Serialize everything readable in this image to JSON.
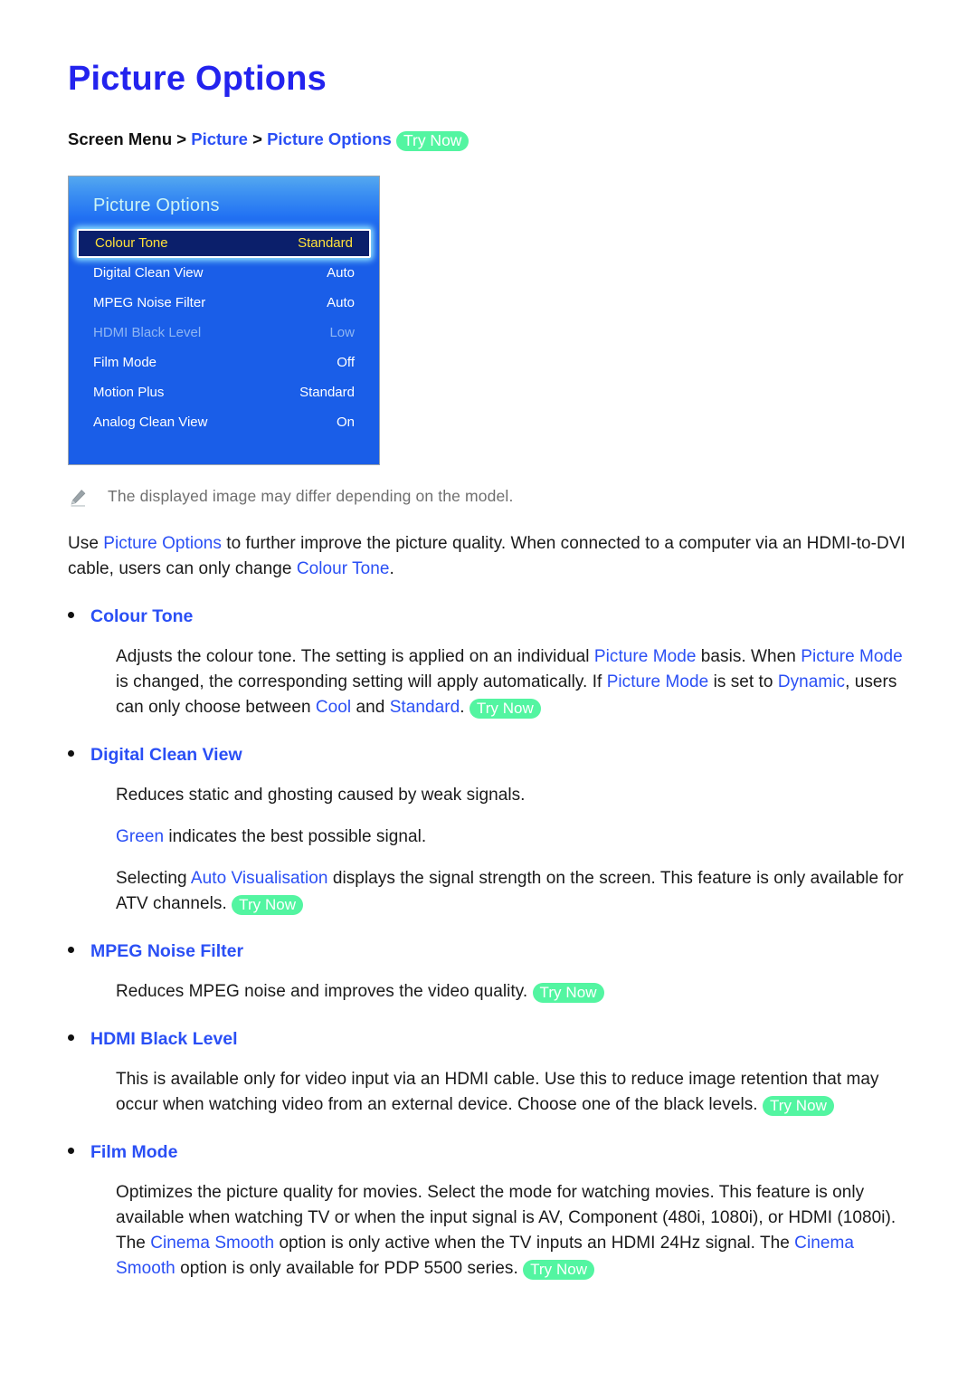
{
  "page": {
    "title": "Picture Options"
  },
  "breadcrumb": {
    "root": "Screen Menu",
    "sep1": ">",
    "level2": "Picture",
    "sep2": ">",
    "level3": "Picture Options",
    "try_now": "Try Now"
  },
  "tv_menu": {
    "title": "Picture Options",
    "rows": [
      {
        "label": "Colour Tone",
        "value": "Standard",
        "state": "selected"
      },
      {
        "label": "Digital Clean View",
        "value": "Auto",
        "state": "normal"
      },
      {
        "label": "MPEG Noise Filter",
        "value": "Auto",
        "state": "normal"
      },
      {
        "label": "HDMI Black Level",
        "value": "Low",
        "state": "disabled"
      },
      {
        "label": "Film Mode",
        "value": "Off",
        "state": "normal"
      },
      {
        "label": "Motion Plus",
        "value": "Standard",
        "state": "normal"
      },
      {
        "label": "Analog Clean View",
        "value": "On",
        "state": "normal"
      }
    ]
  },
  "note": {
    "icon": "pencil-icon",
    "text": "The displayed image may differ depending on the model."
  },
  "intro": {
    "t1": "Use ",
    "k1": "Picture Options",
    "t2": " to further improve the picture quality. When connected to a computer via an HDMI-to-DVI cable, users can only change ",
    "k2": "Colour Tone",
    "t3": "."
  },
  "sections": [
    {
      "heading": "Colour Tone",
      "paragraphs": [
        {
          "parts": [
            {
              "type": "text",
              "v": "Adjusts the colour tone. The setting is applied on an individual "
            },
            {
              "type": "kw",
              "v": "Picture Mode"
            },
            {
              "type": "text",
              "v": " basis. When "
            },
            {
              "type": "kw",
              "v": "Picture Mode"
            },
            {
              "type": "text",
              "v": " is changed, the corresponding setting will apply automatically. If "
            },
            {
              "type": "kw",
              "v": "Picture Mode"
            },
            {
              "type": "text",
              "v": " is set to "
            },
            {
              "type": "kw",
              "v": "Dynamic"
            },
            {
              "type": "text",
              "v": ", users can only choose between "
            },
            {
              "type": "kw",
              "v": "Cool"
            },
            {
              "type": "text",
              "v": " and "
            },
            {
              "type": "kw",
              "v": "Standard"
            },
            {
              "type": "text",
              "v": ". "
            },
            {
              "type": "badge",
              "v": "Try Now"
            }
          ]
        }
      ]
    },
    {
      "heading": "Digital Clean View",
      "paragraphs": [
        {
          "parts": [
            {
              "type": "text",
              "v": "Reduces static and ghosting caused by weak signals."
            }
          ]
        },
        {
          "parts": [
            {
              "type": "kw",
              "v": "Green"
            },
            {
              "type": "text",
              "v": " indicates the best possible signal."
            }
          ]
        },
        {
          "parts": [
            {
              "type": "text",
              "v": "Selecting "
            },
            {
              "type": "kw",
              "v": "Auto Visualisation"
            },
            {
              "type": "text",
              "v": " displays the signal strength on the screen. This feature is only available for ATV channels. "
            },
            {
              "type": "badge",
              "v": "Try Now"
            }
          ]
        }
      ]
    },
    {
      "heading": "MPEG Noise Filter",
      "paragraphs": [
        {
          "parts": [
            {
              "type": "text",
              "v": "Reduces MPEG noise and improves the video quality. "
            },
            {
              "type": "badge",
              "v": "Try Now"
            }
          ]
        }
      ]
    },
    {
      "heading": "HDMI Black Level",
      "paragraphs": [
        {
          "parts": [
            {
              "type": "text",
              "v": "This is available only for video input via an HDMI cable. Use this to reduce image retention that may occur when watching video from an external device. Choose one of the black levels. "
            },
            {
              "type": "badge",
              "v": "Try Now"
            }
          ]
        }
      ]
    },
    {
      "heading": "Film Mode",
      "paragraphs": [
        {
          "parts": [
            {
              "type": "text",
              "v": "Optimizes the picture quality for movies. Select the mode for watching movies. This feature is only available when watching TV or when the input signal is AV, Component (480i, 1080i), or HDMI (1080i). The "
            },
            {
              "type": "kw",
              "v": "Cinema Smooth"
            },
            {
              "type": "text",
              "v": " option is only active when the TV inputs an HDMI 24Hz signal. The "
            },
            {
              "type": "kw",
              "v": "Cinema Smooth"
            },
            {
              "type": "text",
              "v": " option is only available for PDP 5500 series. "
            },
            {
              "type": "badge",
              "v": "Try Now"
            }
          ]
        }
      ]
    }
  ],
  "colors": {
    "title_blue": "#2323ee",
    "keyword_blue": "#2a4ff5",
    "badge_green": "#53f5a1",
    "menu_blue": "#1a5ee8",
    "selected_navy": "#0b1f6b",
    "selected_yellow": "#ffe13a",
    "disabled_text": "#8fb6f3",
    "note_gray": "#6f6f6f"
  }
}
